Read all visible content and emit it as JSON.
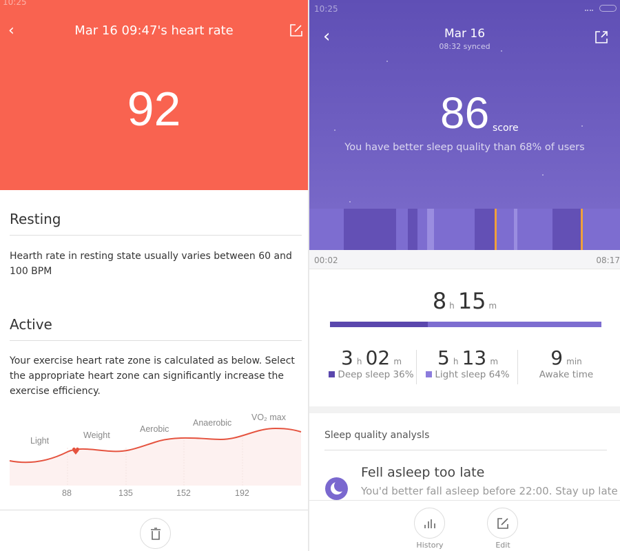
{
  "heart": {
    "status_time": "10:25",
    "title": "Mar 16 09:47's heart rate",
    "value": "92",
    "resting_title": "Resting",
    "resting_text": "Hearth rate in resting state usually varies between 60 and 100 BPM",
    "active_title": "Active",
    "active_text": "Your exercise heart rate zone is calculated as below. Select the appropriate heart zone can significantly increase the exercise efficiency.",
    "zones": [
      "Light",
      "Weight",
      "Aerobic",
      "Anaerobic",
      "VO₂ max"
    ],
    "ticks": [
      "88",
      "135",
      "152",
      "192"
    ],
    "accent": "#f96350"
  },
  "sleep": {
    "status_time": "10:25",
    "title": "Mar 16",
    "synced": "08:32 synced",
    "score": "86",
    "score_unit": "score",
    "comparison": "You have better sleep quality than 68% of users",
    "start_time": "00:02",
    "end_time": "08:17",
    "total_h": "8",
    "total_m": "15",
    "h": "h",
    "m": "m",
    "min": "min",
    "deep_h": "3",
    "deep_m": "02",
    "deep_label": "Deep sleep 36%",
    "deep_fraction": 0.36,
    "light_h": "5",
    "light_m": "13",
    "light_label": "Light sleep 64%",
    "awake": "9",
    "awake_label": "Awake time",
    "analysis_title": "Sleep quality analysls",
    "issue_title": "Fell asleep too late",
    "issue_text": "You'd better fall asleep before 22:00. Stay up late",
    "history_label": "History",
    "edit_label": "Edit",
    "colors": {
      "deep": "#6350b5",
      "light": "#7d6dd0",
      "awake": "#f0a03c",
      "header": "#5f4fb5"
    }
  }
}
